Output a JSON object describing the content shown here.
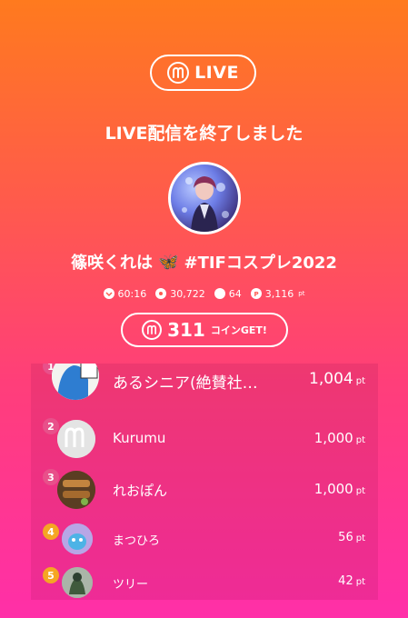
{
  "header": {
    "live_label": "LIVE"
  },
  "title": "LIVE配信を終了しました",
  "streamer": {
    "name": "篠咲くれは",
    "emoji": "🦋",
    "tag": "#TIFコスプレ2022"
  },
  "stats": {
    "duration": "60:16",
    "viewers": "30,722",
    "comments": "64",
    "points": "3,116",
    "points_unit": "pt"
  },
  "coins": {
    "amount": "311",
    "suffix": "コインGET!"
  },
  "ranking": [
    {
      "rank": "1",
      "name": "あるシニア(絶賛社…",
      "points": "1,004",
      "unit": "pt",
      "badge_color": "#e8508a"
    },
    {
      "rank": "2",
      "name": "Kurumu",
      "points": "1,000",
      "unit": "pt",
      "badge_color": "#e8508a"
    },
    {
      "rank": "3",
      "name": "れおぽん",
      "points": "1,000",
      "unit": "pt",
      "badge_color": "#e8508a"
    },
    {
      "rank": "4",
      "name": "まつひろ",
      "points": "56",
      "unit": "pt",
      "badge_color": "#f5a623"
    },
    {
      "rank": "5",
      "name": "ツリー",
      "points": "42",
      "unit": "pt",
      "badge_color": "#f5a623"
    }
  ],
  "icons": [
    "mirrativ-logo-icon",
    "clock-icon",
    "viewers-icon",
    "comment-icon",
    "point-icon",
    "coin-icon"
  ]
}
